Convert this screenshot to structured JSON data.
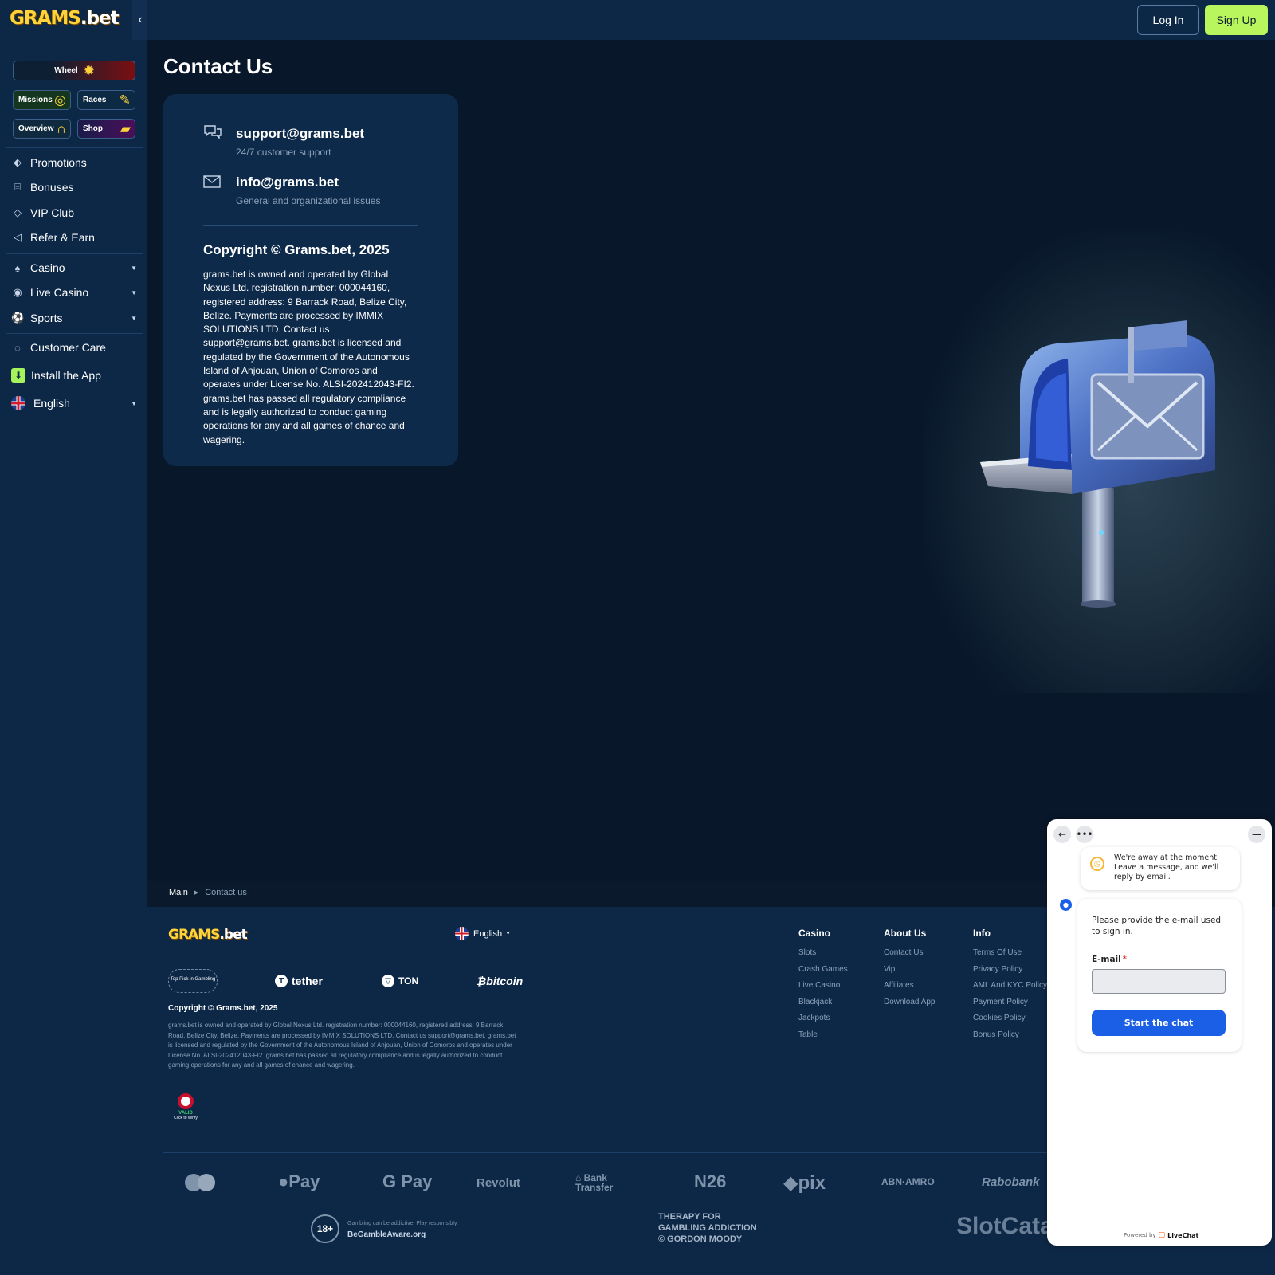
{
  "brand": {
    "logo_main": "GRAMS",
    "logo_dot": ".bet"
  },
  "header": {
    "collapse_icon": "chevron-left-icon",
    "login_label": "Log In",
    "signup_label": "Sign Up",
    "signup_color": "#b9f55d"
  },
  "sidebar": {
    "pills": {
      "wheel": "Wheel",
      "missions": "Missions",
      "races": "Races",
      "overview": "Overview",
      "shop": "Shop"
    },
    "items": [
      {
        "label": "Promotions",
        "icon": "tag-icon"
      },
      {
        "label": "Bonuses",
        "icon": "gift-icon"
      },
      {
        "label": "VIP Club",
        "icon": "diamond-icon"
      },
      {
        "label": "Refer & Earn",
        "icon": "megaphone-icon"
      },
      {
        "label": "Casino",
        "icon": "cards-icon"
      },
      {
        "label": "Live Casino",
        "icon": "live-casino-icon"
      },
      {
        "label": "Sports",
        "icon": "soccer-ball-icon"
      },
      {
        "label": "Customer Care",
        "icon": "chat-icon"
      },
      {
        "label": "Install the App",
        "icon": "download-icon"
      },
      {
        "label": "English",
        "icon": "uk-flag-icon"
      }
    ]
  },
  "page": {
    "title": "Contact Us"
  },
  "contact": {
    "support_email": "support@grams.bet",
    "support_sub": "24/7 customer support",
    "info_email": "info@grams.bet",
    "info_sub": "General and organizational issues",
    "copyright": "Copyright © Grams.bet, 2025",
    "legal": "grams.bet is owned and operated by Global Nexus Ltd. registration number: 000044160, registered address: 9 Barrack Road, Belize City, Belize. Payments are processed by IMMIX SOLUTIONS LTD. Contact us support@grams.bet. grams.bet is licensed and regulated by the Government of the Autonomous Island of Anjouan, Union of Comoros and operates under License No. ALSI-202412043-FI2. grams.bet has passed all regulatory compliance and is legally authorized to conduct gaming operations for any and all games of chance and wagering."
  },
  "breadcrumb": {
    "main": "Main",
    "current": "Contact us"
  },
  "footer": {
    "lang": "English",
    "crypto": [
      "tether",
      "TON",
      "bitcoin"
    ],
    "toppick": "Top Pick in Gambling",
    "copyright": "Copyright © Grams.bet, 2025",
    "legal": "grams.bet is owned and operated by Global Nexus Ltd. registration number: 000044160, registered address: 9 Barrack Road, Belize City, Belize. Payments are processed by IMMIX SOLUTIONS LTD. Contact us support@grams.bet. grams.bet is licensed and regulated by the Government of the Autonomous Island of Anjouan, Union of Comoros and operates under License No. ALSI-202412043-FI2. grams.bet has passed all regulatory compliance and is legally authorized to conduct gaming operations for any and all games of chance and wagering.",
    "valid": {
      "label": "VALID",
      "sub": "Click to verify"
    },
    "columns": {
      "casino": {
        "title": "Casino",
        "links": [
          "Slots",
          "Crash Games",
          "Live Casino",
          "Blackjack",
          "Jackpots",
          "Table"
        ]
      },
      "about": {
        "title": "About Us",
        "links": [
          "Contact Us",
          "Vip",
          "Affiliates",
          "Download App"
        ]
      },
      "info": {
        "title": "Info",
        "links": [
          "Terms Of Use",
          "Privacy Policy",
          "AML And KYC Policy",
          "Payment Policy",
          "Cookies Policy",
          "Bonus Policy"
        ]
      }
    },
    "payments": [
      "Pay",
      "G Pay",
      "Revolut",
      "Bank Transfer",
      "N26",
      "pix",
      "ABN·AMRO",
      "Rabobank"
    ],
    "age": "18+",
    "resp_line1": "Gambling can be addictive. Play responsibly.",
    "resp_line2": "BeGambleAware.org",
    "therapy": [
      "THERAPY FOR",
      "GAMBLING ADDICTION",
      "© GORDON MOODY"
    ],
    "slotcata": "SlotCata"
  },
  "chat": {
    "away": "We're away at the moment. Leave a message, and we'll reply by email.",
    "prompt": "Please provide the e-mail used to sign in.",
    "email_label": "E-mail",
    "required_mark": "*",
    "start_label": "Start the chat",
    "powered_by": "Powered by",
    "livechat": "LiveChat",
    "accent": "#1a5fe6"
  }
}
